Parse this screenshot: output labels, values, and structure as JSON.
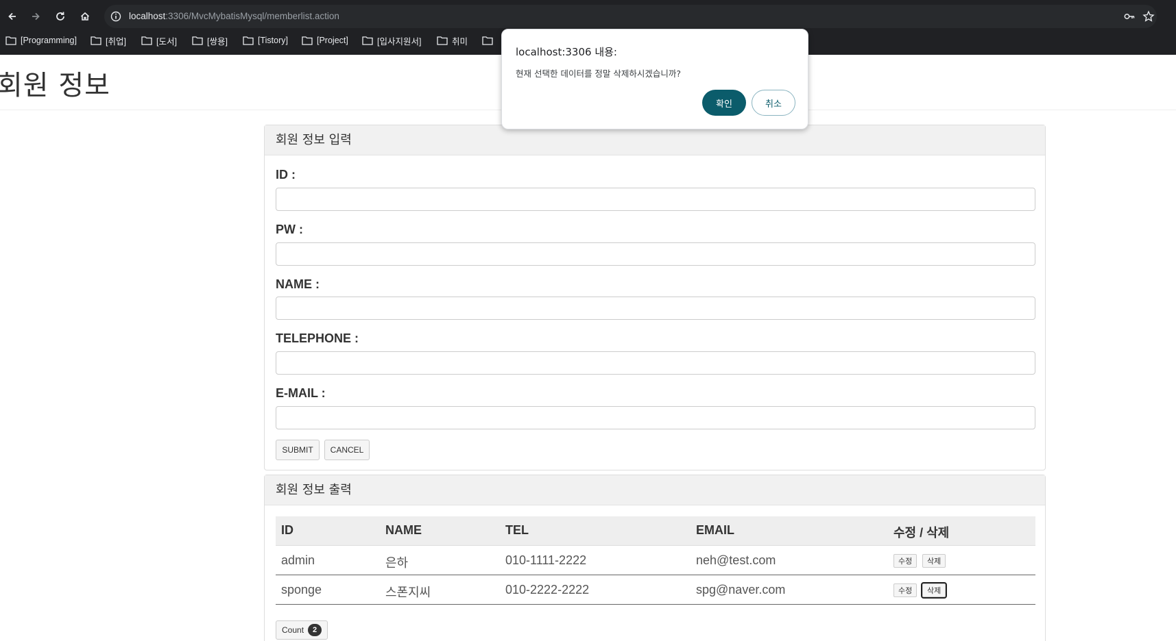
{
  "browser": {
    "url_host": "localhost",
    "url_rest": ":3306/MvcMybatisMysql/memberlist.action",
    "bookmarks": [
      "[Programming]",
      "[취업]",
      "[도서]",
      "[쌍용]",
      "[Tistory]",
      "[Project]",
      "[입사지원서]",
      "취미"
    ]
  },
  "page": {
    "title": "회원 정보"
  },
  "input_panel": {
    "heading": "회원 정보 입력",
    "fields": [
      {
        "label": "ID :",
        "value": ""
      },
      {
        "label": "PW :",
        "value": ""
      },
      {
        "label": "NAME :",
        "value": ""
      },
      {
        "label": "TELEPHONE :",
        "value": ""
      },
      {
        "label": "E-MAIL :",
        "value": ""
      }
    ],
    "submit_label": "SUBMIT",
    "cancel_label": "CANCEL"
  },
  "output_panel": {
    "heading": "회원 정보 출력",
    "columns": [
      "ID",
      "NAME",
      "TEL",
      "EMAIL",
      "수정 / 삭제"
    ],
    "rows": [
      {
        "id": "admin",
        "name": "은하",
        "tel": "010-1111-2222",
        "email": "neh@test.com",
        "edit": "수정",
        "delete": "삭제"
      },
      {
        "id": "sponge",
        "name": "스폰지씨",
        "tel": "010-2222-2222",
        "email": "spg@naver.com",
        "edit": "수정",
        "delete": "삭제"
      }
    ],
    "count_label": "Count",
    "count_value": "2"
  },
  "dialog": {
    "title": "localhost:3306 내용:",
    "message": "현재 선택한 데이터를 정말 삭제하시겠습니까?",
    "ok_label": "확인",
    "cancel_label": "취소",
    "accent_color": "#0b5c6b"
  }
}
